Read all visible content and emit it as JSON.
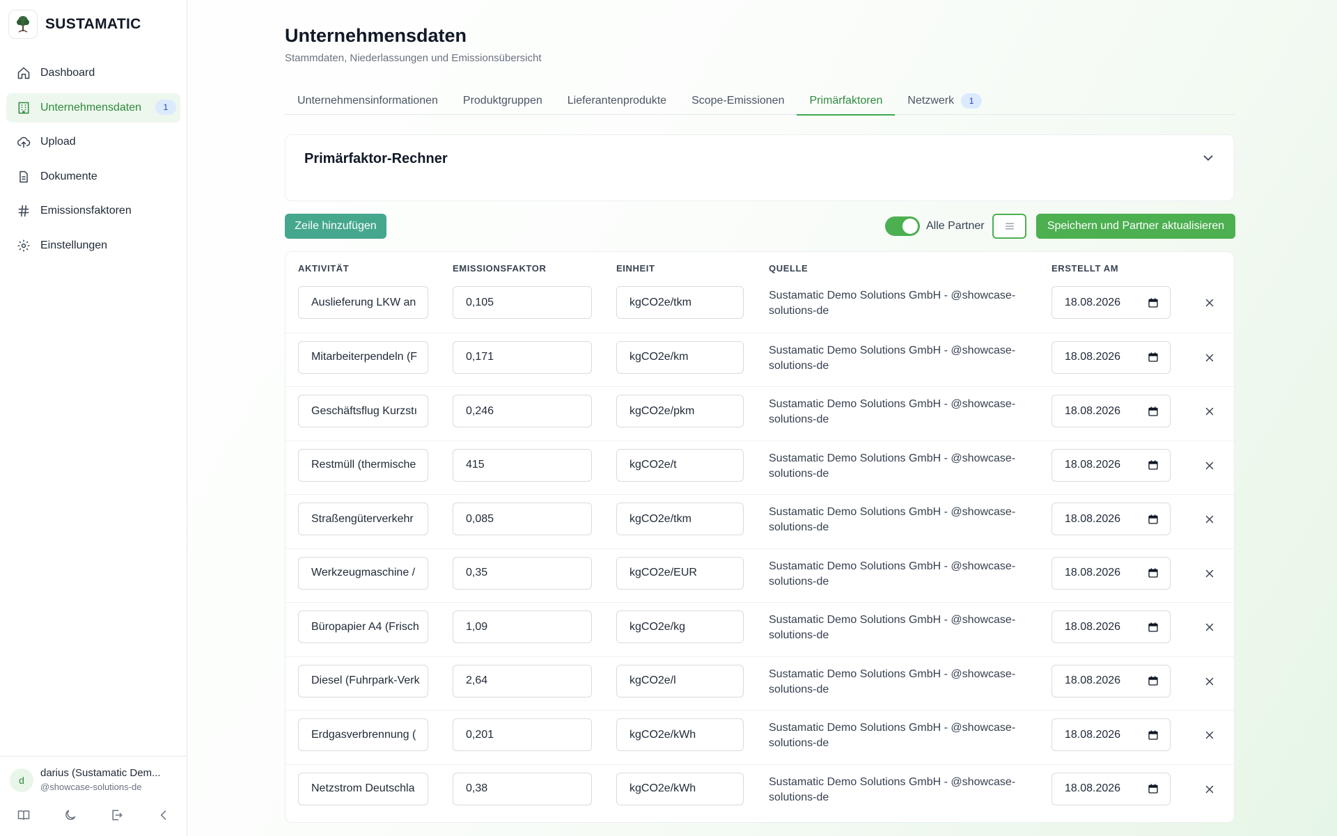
{
  "brand": {
    "name": "SUSTAMATIC"
  },
  "sidebar": {
    "items": [
      {
        "label": "Dashboard",
        "icon": "home-icon"
      },
      {
        "label": "Unternehmensdaten",
        "icon": "building-icon",
        "badge": "1",
        "active": true
      },
      {
        "label": "Upload",
        "icon": "cloud-upload-icon"
      },
      {
        "label": "Dokumente",
        "icon": "document-icon"
      },
      {
        "label": "Emissionsfaktoren",
        "icon": "hash-icon"
      },
      {
        "label": "Einstellungen",
        "icon": "gear-icon"
      }
    ]
  },
  "user": {
    "initial": "d",
    "name": "darius (Sustamatic Dem...",
    "handle": "@showcase-solutions-de"
  },
  "page": {
    "title": "Unternehmensdaten",
    "subtitle": "Stammdaten, Niederlassungen und Emissionsübersicht"
  },
  "tabs": [
    {
      "label": "Unternehmensinformationen"
    },
    {
      "label": "Produktgruppen"
    },
    {
      "label": "Lieferantenprodukte"
    },
    {
      "label": "Scope-Emissionen"
    },
    {
      "label": "Primärfaktoren",
      "active": true
    },
    {
      "label": "Netzwerk",
      "badge": "1"
    }
  ],
  "calculator": {
    "title": "Primärfaktor-Rechner"
  },
  "toolbar": {
    "add_row": "Zeile hinzufügen",
    "toggle_label": "Alle Partner",
    "toggle_on": true,
    "save": "Speichern und Partner aktualisieren"
  },
  "table": {
    "headers": {
      "activity": "AKTIVITÄT",
      "factor": "EMISSIONSFAKTOR",
      "unit": "EINHEIT",
      "source": "QUELLE",
      "created": "ERSTELLT AM"
    },
    "rows": [
      {
        "activity": "Auslieferung LKW an",
        "factor": "0,105",
        "unit": "kgCO2e/tkm",
        "source": "Sustamatic Demo Solutions GmbH - @showcase-solutions-de",
        "date": "18.08.2026"
      },
      {
        "activity": "Mitarbeiterpendeln (F",
        "factor": "0,171",
        "unit": "kgCO2e/km",
        "source": "Sustamatic Demo Solutions GmbH - @showcase-solutions-de",
        "date": "18.08.2026"
      },
      {
        "activity": "Geschäftsflug Kurzstı",
        "factor": "0,246",
        "unit": "kgCO2e/pkm",
        "source": "Sustamatic Demo Solutions GmbH - @showcase-solutions-de",
        "date": "18.08.2026"
      },
      {
        "activity": "Restmüll (thermische",
        "factor": "415",
        "unit": "kgCO2e/t",
        "source": "Sustamatic Demo Solutions GmbH - @showcase-solutions-de",
        "date": "18.08.2026"
      },
      {
        "activity": "Straßengüterverkehr",
        "factor": "0,085",
        "unit": "kgCO2e/tkm",
        "source": "Sustamatic Demo Solutions GmbH - @showcase-solutions-de",
        "date": "18.08.2026"
      },
      {
        "activity": "Werkzeugmaschine /",
        "factor": "0,35",
        "unit": "kgCO2e/EUR",
        "source": "Sustamatic Demo Solutions GmbH - @showcase-solutions-de",
        "date": "18.08.2026"
      },
      {
        "activity": "Büropapier A4 (Frisch",
        "factor": "1,09",
        "unit": "kgCO2e/kg",
        "source": "Sustamatic Demo Solutions GmbH - @showcase-solutions-de",
        "date": "18.08.2026"
      },
      {
        "activity": "Diesel (Fuhrpark-Verk",
        "factor": "2,64",
        "unit": "kgCO2e/l",
        "source": "Sustamatic Demo Solutions GmbH - @showcase-solutions-de",
        "date": "18.08.2026"
      },
      {
        "activity": "Erdgasverbrennung (",
        "factor": "0,201",
        "unit": "kgCO2e/kWh",
        "source": "Sustamatic Demo Solutions GmbH - @showcase-solutions-de",
        "date": "18.08.2026"
      },
      {
        "activity": "Netzstrom Deutschla",
        "factor": "0,38",
        "unit": "kgCO2e/kWh",
        "source": "Sustamatic Demo Solutions GmbH - @showcase-solutions-de",
        "date": "18.08.2026"
      }
    ]
  },
  "colors": {
    "accent": "#4caf50",
    "accent_dark": "#2f8a3c",
    "add_button": "#45a78e",
    "badge_bg": "#dbeafe"
  }
}
